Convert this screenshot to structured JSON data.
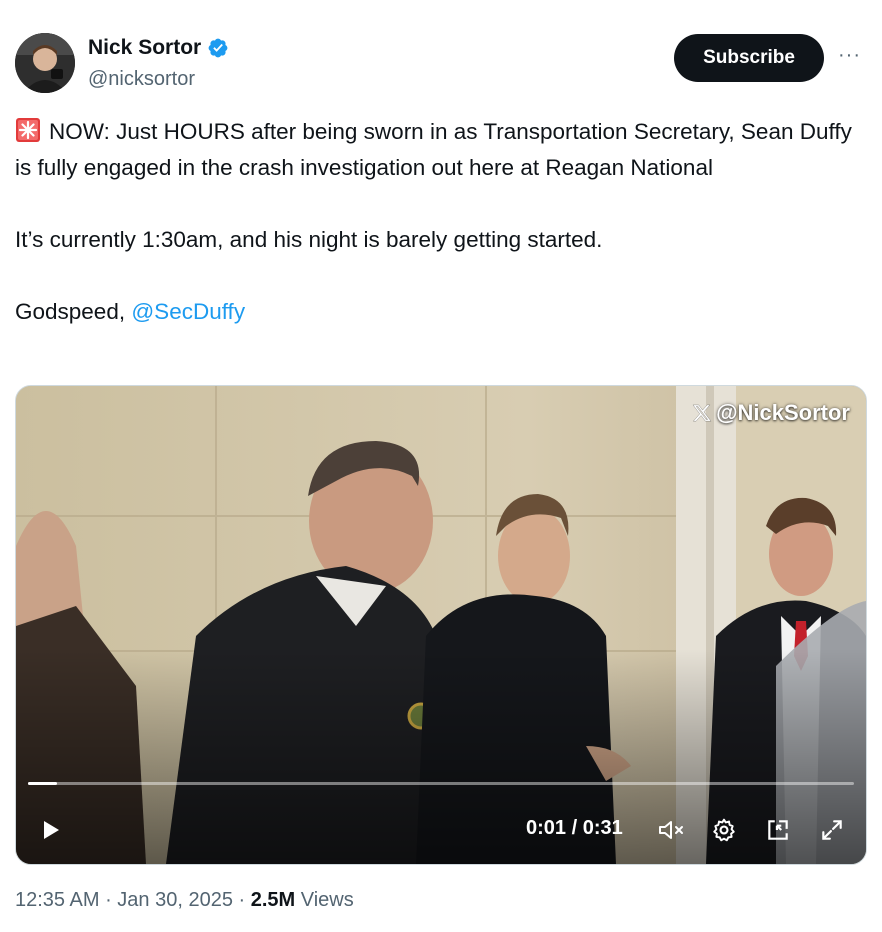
{
  "author": {
    "name": "Nick Sortor",
    "handle": "@nicksortor"
  },
  "header": {
    "subscribe_label": "Subscribe",
    "more_label": "···"
  },
  "tweet": {
    "line1": "NOW: Just HOURS after being sworn in as Transportation Secretary, Sean Duffy is fully engaged in the crash investigation out here at Reagan National",
    "line2": "It’s currently 1:30am, and his night is barely getting started.",
    "line3_prefix": "Godspeed, ",
    "mention": "@SecDuffy"
  },
  "video": {
    "watermark": "@NickSortor",
    "current_time": "0:01",
    "separator": " / ",
    "duration": "0:31",
    "progress": 0.035
  },
  "footer": {
    "time": "12:35 AM",
    "dot1": " · ",
    "date": "Jan 30, 2025",
    "dot2": " · ",
    "views_count": "2.5M",
    "views_label": " Views"
  },
  "colors": {
    "accent": "#1d9bf0",
    "text": "#0f1419",
    "secondary": "#536471"
  }
}
